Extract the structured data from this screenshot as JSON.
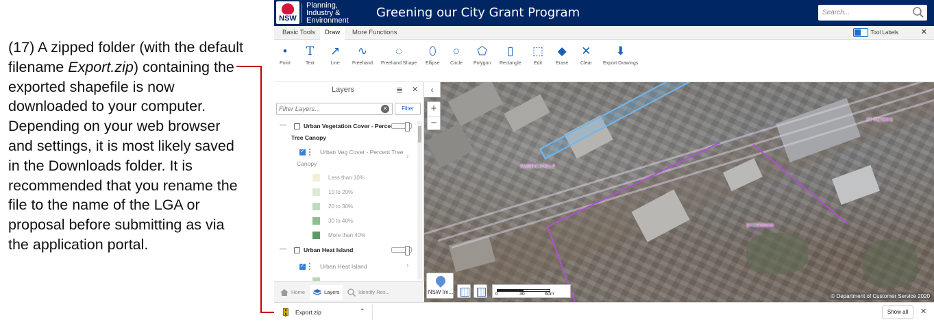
{
  "instruction": {
    "part1": "(17) A zipped folder (with the default filename ",
    "filename": "Export.zip",
    "part2": ") containing the exported shapefile is now downloaded to your computer. Depending on your web browser and settings, it is most likely saved in the Downloads folder. It is recommended that you rename the file to the name of the LGA or proposal before submitting as via the application portal."
  },
  "header": {
    "logo_text": "NSW",
    "dept_line1": "Planning,",
    "dept_line2": "Industry &",
    "dept_line3": "Environment",
    "title": "Greening our City Grant Program",
    "search_placeholder": "Search..."
  },
  "tabs": {
    "items": [
      "Basic Tools",
      "Draw",
      "More Functions"
    ],
    "active": "Draw",
    "tool_labels": "Tool Labels"
  },
  "draw_tools": [
    "Point",
    "Text",
    "Line",
    "Freehand",
    "Freehand Shape",
    "Ellipse",
    "Circle",
    "Polygon",
    "Rectangle",
    "Edit",
    "Erase",
    "Clear",
    "Export Drawings"
  ],
  "layers": {
    "title": "Layers",
    "filter_placeholder": "Filter Layers...",
    "filter_button": "Filter",
    "group1": "Urban Vegetation Cover - Percent Tree Canopy",
    "group1_line1": "Urban Vegetation Cover - Percent",
    "group1_line2": "Tree Canopy",
    "sub1_line1": "Urban Veg Cover - Percent Tree",
    "sub1_line2": "Canopy",
    "legend": [
      {
        "label": "Less than 10%",
        "color": "#f4f0d6"
      },
      {
        "label": "10 to 20%",
        "color": "#d9ebd8"
      },
      {
        "label": "20 to 30%",
        "color": "#bfdcbf"
      },
      {
        "label": "30 to 40%",
        "color": "#8fbf91"
      },
      {
        "label": "More than 40%",
        "color": "#5f9a66"
      }
    ],
    "group2": "Urban Heat Island",
    "sub2": "Urban Heat Island",
    "panel_tabs": [
      "Home",
      "Layers",
      "Identify Res..."
    ]
  },
  "map": {
    "suburbs": [
      "MARRICKVILLE",
      "ST PETERS",
      "SYDENHAM"
    ],
    "basemap_label": "NSW Im...",
    "scale": [
      "0",
      "30",
      "60m"
    ],
    "copyright": "© Department of Customer Service 2020"
  },
  "download": {
    "filename": "Export.zip",
    "show_all": "Show all"
  },
  "colors": {
    "header_bg": "#002664",
    "accent": "#1a5fb4",
    "callout": "#c00000",
    "lga_boundary": "#b14fd3",
    "selection": "#6fb6f0"
  }
}
